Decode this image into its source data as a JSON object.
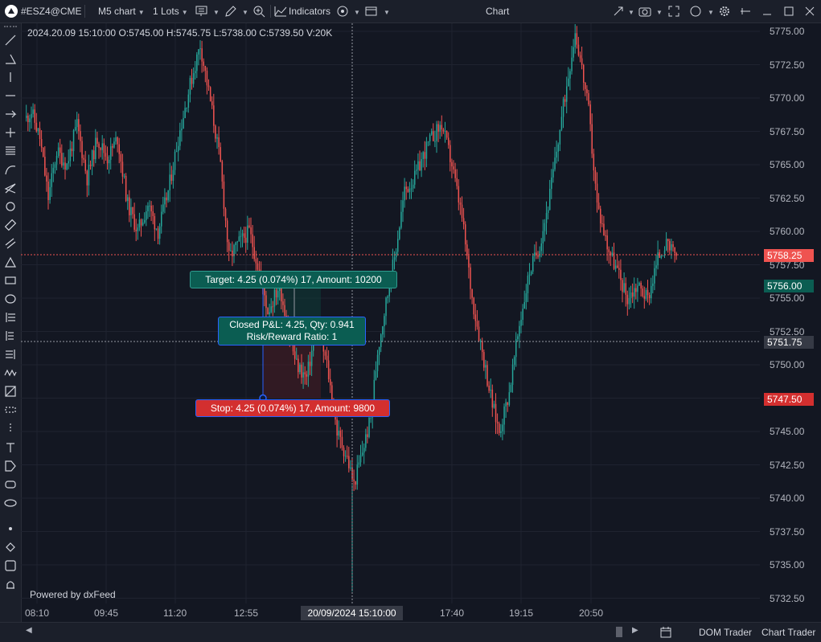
{
  "toolbar": {
    "symbol": "#ESZ4@CME",
    "timeframe": "M5 chart",
    "lots": "1 Lots",
    "indicators": "Indicators",
    "window_title": "Chart"
  },
  "ohlc_line": "2024.20.09 15:10:00 O:5745.00 H:5745.75 L:5738.00 C:5739.50 V:20K",
  "powered_by": "Powered by dxFeed",
  "price_axis_labels": [
    "5775.00",
    "5772.50",
    "5770.00",
    "5767.50",
    "5765.00",
    "5762.50",
    "5760.00",
    "5757.50",
    "5755.00",
    "5752.50",
    "5750.00",
    "5747.50",
    "5745.00",
    "5742.50",
    "5740.00",
    "5737.50",
    "5735.00",
    "5732.50"
  ],
  "price_tags": {
    "current": "5758.25",
    "target": "5756.00",
    "crosshair": "5751.75",
    "stop": "5747.50"
  },
  "time_axis_labels": [
    "08:10",
    "09:45",
    "11:20",
    "12:55",
    "17:40",
    "19:15",
    "20:50"
  ],
  "crosshair_time": "20/09/2024 15:10:00",
  "trade": {
    "target_label": "Target: 4.25 (0.074%) 17, Amount: 10200",
    "closed_label_line1": "Closed P&L: 4.25, Qty: 0.941",
    "closed_label_line2": "Risk/Reward Ratio: 1",
    "stop_label": "Stop: 4.25 (0.074%) 17, Amount: 9800"
  },
  "bottombar": {
    "dom_trader": "DOM Trader",
    "chart_trader": "Chart Trader"
  },
  "colors": {
    "background": "#131722",
    "up": "#26a69a",
    "down": "#ef5350",
    "target": "#0b5d52",
    "stop": "#d32f2f"
  },
  "icons": {
    "left_toolbar": [
      "line-tool-icon",
      "angle-tool-icon",
      "vertical-line-icon",
      "horizontal-line-icon",
      "arrow-icon",
      "crosshair-icon",
      "fib-icon",
      "curve-icon",
      "pitchfork-icon",
      "spiral-icon",
      "ruler-icon",
      "parallel-channel-icon",
      "triangle-icon",
      "rectangle-icon",
      "ellipse-icon",
      "long-position-icon",
      "short-position-icon",
      "gann-icon",
      "elliott-icon",
      "projection-icon",
      "dotted-rect-icon",
      "dotted-vertical-icon",
      "text-icon",
      "price-label-icon",
      "callout-icon",
      "note-icon",
      "dot-icon",
      "diamond-icon",
      "rect-outline-icon",
      "bell-icon"
    ]
  }
}
